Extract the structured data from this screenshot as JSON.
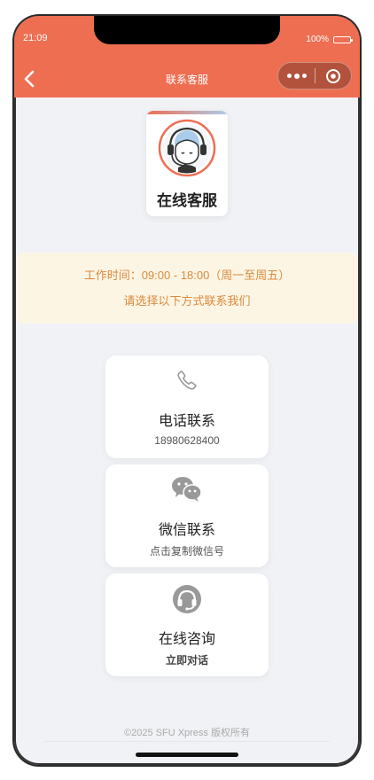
{
  "status_bar": {
    "time": "21:09",
    "battery": "100%"
  },
  "nav": {
    "title": "联系客服",
    "back_icon": "chevron-left-icon",
    "more_icon": "more-dots-icon",
    "close_icon": "target-circle-icon"
  },
  "logo": {
    "title": "在线客服",
    "icon": "customer-service-headset-avatar"
  },
  "notice": {
    "line1": "工作时间：09:00 - 18:00（周一至周五）",
    "line2": "请选择以下方式联系我们"
  },
  "contacts": [
    {
      "icon": "phone-icon",
      "title": "电话联系",
      "subtitle": "18980628400"
    },
    {
      "icon": "wechat-icon",
      "title": "微信联系",
      "subtitle": "点击复制微信号"
    },
    {
      "icon": "headset-icon",
      "title": "在线咨询",
      "subtitle": "立即对话"
    }
  ],
  "footer": {
    "copyright": "©2025 SFU Xpress 版权所有"
  },
  "colors": {
    "accent": "#ee6e52",
    "notice_bg": "#fdf5e4",
    "notice_text": "#d98a3c",
    "page_bg": "#f0f2f5"
  }
}
